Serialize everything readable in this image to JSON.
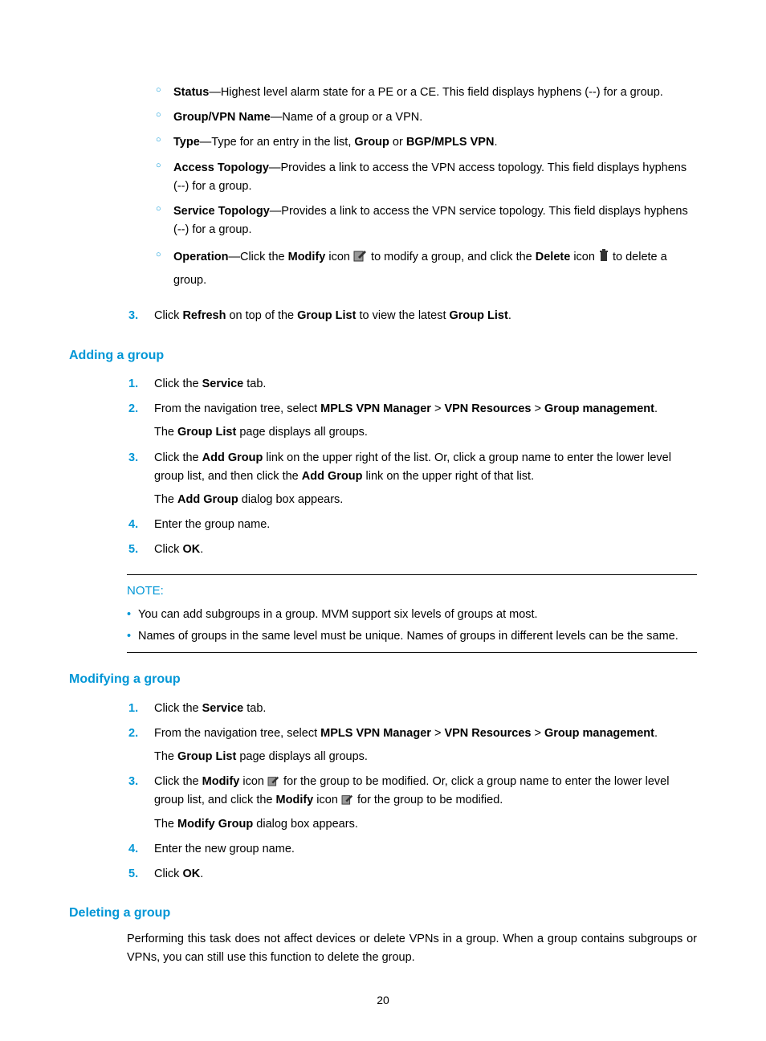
{
  "fields": [
    {
      "label": "Status",
      "text": "—Highest level alarm state for a PE or a CE. This field displays hyphens (--) for a group."
    },
    {
      "label": "Group/VPN Name",
      "text": "—Name of a group or a VPN."
    },
    {
      "label": "Type",
      "pre": "—Type for an entry in the list, ",
      "mid1": "Group",
      "mid2": " or ",
      "mid3": "BGP/MPLS VPN",
      "post": "."
    },
    {
      "label": "Access Topology",
      "text": "—Provides a link to access the VPN access topology. This field displays hyphens (--) for a group."
    },
    {
      "label": "Service Topology",
      "text": "—Provides a link to access the VPN service topology. This field displays hyphens (--) for a group."
    },
    {
      "label": "Operation",
      "op_a": "—Click the ",
      "op_b": "Modify",
      "op_c": " icon ",
      "op_d": " to modify a group, and click the ",
      "op_e": "Delete",
      "op_f": " icon ",
      "op_g": " to delete a group."
    }
  ],
  "refresh": {
    "a": "Click ",
    "b": "Refresh",
    "c": " on top of the ",
    "d": "Group List",
    "e": " to view the latest ",
    "f": "Group List",
    "g": "."
  },
  "refresh_num": "3.",
  "adding_heading": "Adding a group",
  "adding": {
    "items": [
      {
        "num": "1.",
        "a": "Click the ",
        "b": "Service",
        "c": " tab."
      },
      {
        "num": "2.",
        "a": "From the navigation tree, select ",
        "b": "MPLS VPN Manager",
        "c": " > ",
        "d": "VPN Resources",
        "e": " > ",
        "f": "Group management",
        "g": ".",
        "cont_a": "The ",
        "cont_b": "Group List",
        "cont_c": " page displays all groups."
      },
      {
        "num": "3.",
        "a": "Click the ",
        "b": "Add Group",
        "c": " link on the upper right of the list. Or, click a group name to enter the lower level group list, and then click the ",
        "d": "Add Group",
        "e": " link on the upper right of that list.",
        "cont_a": "The ",
        "cont_b": "Add Group",
        "cont_c": " dialog box appears."
      },
      {
        "num": "4.",
        "a": "Enter the group name."
      },
      {
        "num": "5.",
        "a": "Click ",
        "b": "OK",
        "c": "."
      }
    ]
  },
  "note_label": "NOTE:",
  "note_items": [
    "You can add subgroups in a group. MVM support six levels of groups at most.",
    "Names of groups in the same level must be unique. Names of groups in different levels can be the same."
  ],
  "modifying_heading": "Modifying a group",
  "modifying": {
    "items": [
      {
        "num": "1.",
        "a": "Click the ",
        "b": "Service",
        "c": " tab."
      },
      {
        "num": "2.",
        "a": "From the navigation tree, select ",
        "b": "MPLS VPN Manager",
        "c": " > ",
        "d": "VPN Resources",
        "e": " > ",
        "f": "Group management",
        "g": ".",
        "cont_a": "The ",
        "cont_b": "Group List",
        "cont_c": " page displays all groups."
      },
      {
        "num": "3.",
        "a": "Click the ",
        "b": "Modify",
        "c": " icon ",
        "d": " for the group to be modified. Or, click a group name to enter the lower level group list, and click the ",
        "e": "Modify",
        "f": " icon ",
        "g": " for the group to be modified.",
        "cont_a": "The ",
        "cont_b": "Modify Group",
        "cont_c": " dialog box appears."
      },
      {
        "num": "4.",
        "a": "Enter the new group name."
      },
      {
        "num": "5.",
        "a": "Click ",
        "b": "OK",
        "c": "."
      }
    ]
  },
  "deleting_heading": "Deleting a group",
  "deleting_para": "Performing this task does not affect devices or delete VPNs in a group. When a group contains subgroups or VPNs, you can still use this function to delete the group.",
  "page_number": "20"
}
